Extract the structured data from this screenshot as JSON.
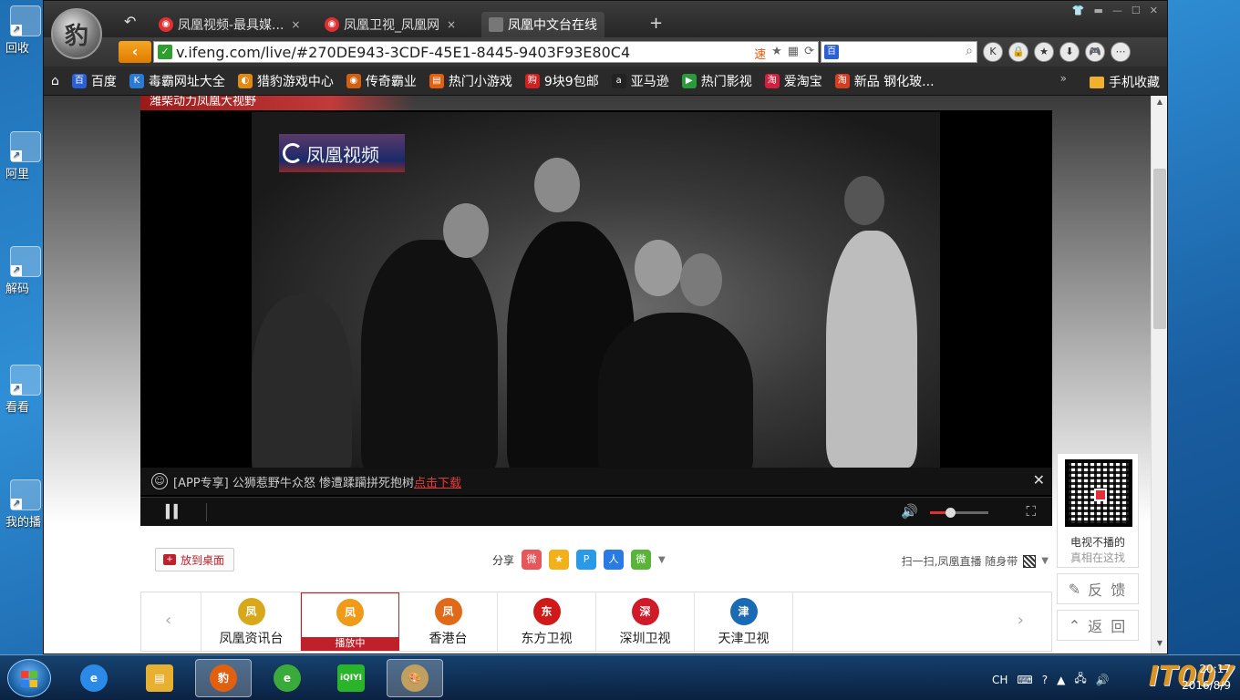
{
  "desktop": {
    "icons": [
      {
        "label": "回收"
      },
      {
        "label": "阿里"
      },
      {
        "label": "解码"
      },
      {
        "label": "看看"
      },
      {
        "label": "我的播"
      }
    ]
  },
  "browser": {
    "tabs": [
      {
        "label": "凤凰视频-最具媒...",
        "close": "×"
      },
      {
        "label": "凤凰卫视_凤凰网",
        "close": "×"
      },
      {
        "label": "凤凰中文台在线",
        "close": ""
      }
    ],
    "new_tab": "+",
    "url": "v.ifeng.com/live/#270DE943-3CDF-45E1-8445-9403F93E80C4",
    "bookmarks": [
      {
        "label": "百度",
        "color": "#2a5fd6"
      },
      {
        "label": "毒霸网址大全",
        "color": "#2a7ad6"
      },
      {
        "label": "猎豹游戏中心",
        "color": "#e08a10"
      },
      {
        "label": "传奇霸业",
        "color": "#d06010"
      },
      {
        "label": "热门小游戏",
        "color": "#e06010"
      },
      {
        "label": "9块9包邮",
        "color": "#d02020"
      },
      {
        "label": "亚马逊",
        "color": "#222222"
      },
      {
        "label": "热门影视",
        "color": "#2a9a3a"
      },
      {
        "label": "爱淘宝",
        "color": "#d02040"
      },
      {
        "label": "新品 钢化玻...",
        "color": "#d04020"
      }
    ],
    "mobile_fav": "手机收藏"
  },
  "page": {
    "banner_text": "潍柴动力凤凰大视野",
    "video_logo": "凤凰视频",
    "ticker": {
      "text": "[APP专享] 公狮惹野牛众怒 惨遭蹂躏拼死抱树",
      "link": "点击下载"
    },
    "volume": 0.35,
    "desk_button": "放到桌面",
    "share_label": "分享",
    "share_icons": [
      {
        "name": "weibo",
        "color": "#e6565a",
        "glyph": "微"
      },
      {
        "name": "qzone",
        "color": "#f2b01a",
        "glyph": "★"
      },
      {
        "name": "pengyou",
        "color": "#2a9ae6",
        "glyph": "P"
      },
      {
        "name": "renren",
        "color": "#2a7ae6",
        "glyph": "人"
      },
      {
        "name": "wechat",
        "color": "#5ab43a",
        "glyph": "微"
      }
    ],
    "scan_text": "扫一扫,凤凰直播 随身带",
    "channels": [
      {
        "name": "凤凰资讯台",
        "color": "#d9a81a",
        "glyph": "凤",
        "playing": false
      },
      {
        "name": "播放中",
        "color": "#f09a1a",
        "glyph": "凤",
        "playing": true
      },
      {
        "name": "香港台",
        "color": "#e06a1a",
        "glyph": "凤",
        "playing": false
      },
      {
        "name": "东方卫视",
        "color": "#d01a1a",
        "glyph": "东",
        "playing": false
      },
      {
        "name": "深圳卫视",
        "color": "#d01a2a",
        "glyph": "深",
        "playing": false
      },
      {
        "name": "天津卫视",
        "color": "#1a6ab4",
        "glyph": "津",
        "playing": false
      }
    ],
    "side": {
      "line1": "电视不播的",
      "line2": "真相在这找",
      "feedback": "反 馈",
      "back": "返 回"
    }
  },
  "taskbar": {
    "tray_lang": "CH",
    "time": "20:17",
    "date": "2016/8/9",
    "watermark": "IT007"
  }
}
